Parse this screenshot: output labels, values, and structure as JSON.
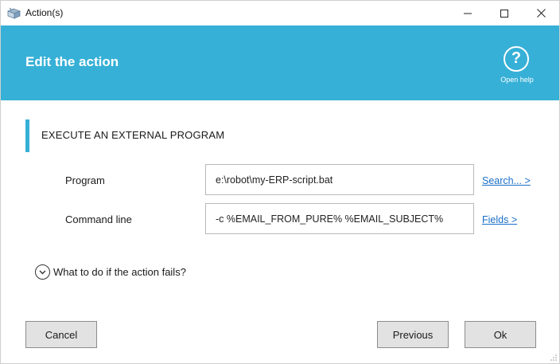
{
  "window": {
    "title": "Action(s)",
    "controls": {
      "minimize_icon": "minimize-icon",
      "maximize_icon": "maximize-icon",
      "close_icon": "close-icon"
    }
  },
  "header": {
    "title": "Edit the action",
    "help": {
      "icon": "question-icon",
      "glyph": "?",
      "label": "Open help"
    },
    "background_color": "#36b0d7"
  },
  "section": {
    "title": "EXECUTE AN EXTERNAL PROGRAM",
    "accent_color": "#36b0d7"
  },
  "fields": {
    "program": {
      "label": "Program",
      "value": "e:\\robot\\my-ERP-script.bat",
      "link": "Search... >"
    },
    "command_line": {
      "label": "Command line",
      "value": "-c %EMAIL_FROM_PURE% %EMAIL_SUBJECT%",
      "link": "Fields >"
    }
  },
  "failure_expander": {
    "icon": "chevron-down-icon",
    "label": "What to do if the action fails?"
  },
  "buttons": {
    "cancel": "Cancel",
    "previous": "Previous",
    "ok": "Ok"
  },
  "link_color": "#1a6fc7"
}
